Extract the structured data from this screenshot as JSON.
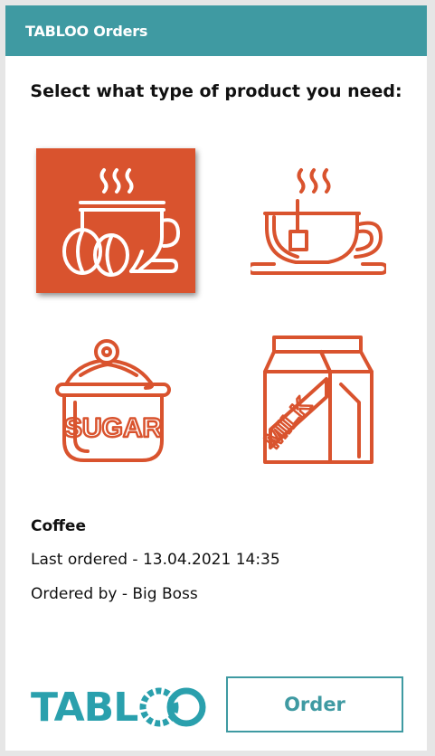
{
  "header": {
    "title": "TABLOO Orders"
  },
  "prompt": "Select what type of product you need:",
  "products": [
    {
      "label": "Coffee",
      "icon": "coffee-icon",
      "selected": true
    },
    {
      "label": "Tea",
      "icon": "tea-cup-icon",
      "selected": false
    },
    {
      "label": "Sugar",
      "icon": "sugar-jar-icon",
      "selected": false,
      "icon_text": "SUGAR"
    },
    {
      "label": "Milk",
      "icon": "milk-carton-icon",
      "selected": false,
      "icon_text": "MILK"
    }
  ],
  "selection": {
    "name": "Coffee",
    "last_ordered": "Last ordered - 13.04.2021 14:35",
    "ordered_by": "Ordered by - Big Boss"
  },
  "footer": {
    "logo_text": "TABL",
    "logo_full": "TABLOO",
    "order_label": "Order"
  },
  "colors": {
    "header": "#3f9aa2",
    "accent": "#d9532e",
    "logo": "#2aa0ad"
  }
}
